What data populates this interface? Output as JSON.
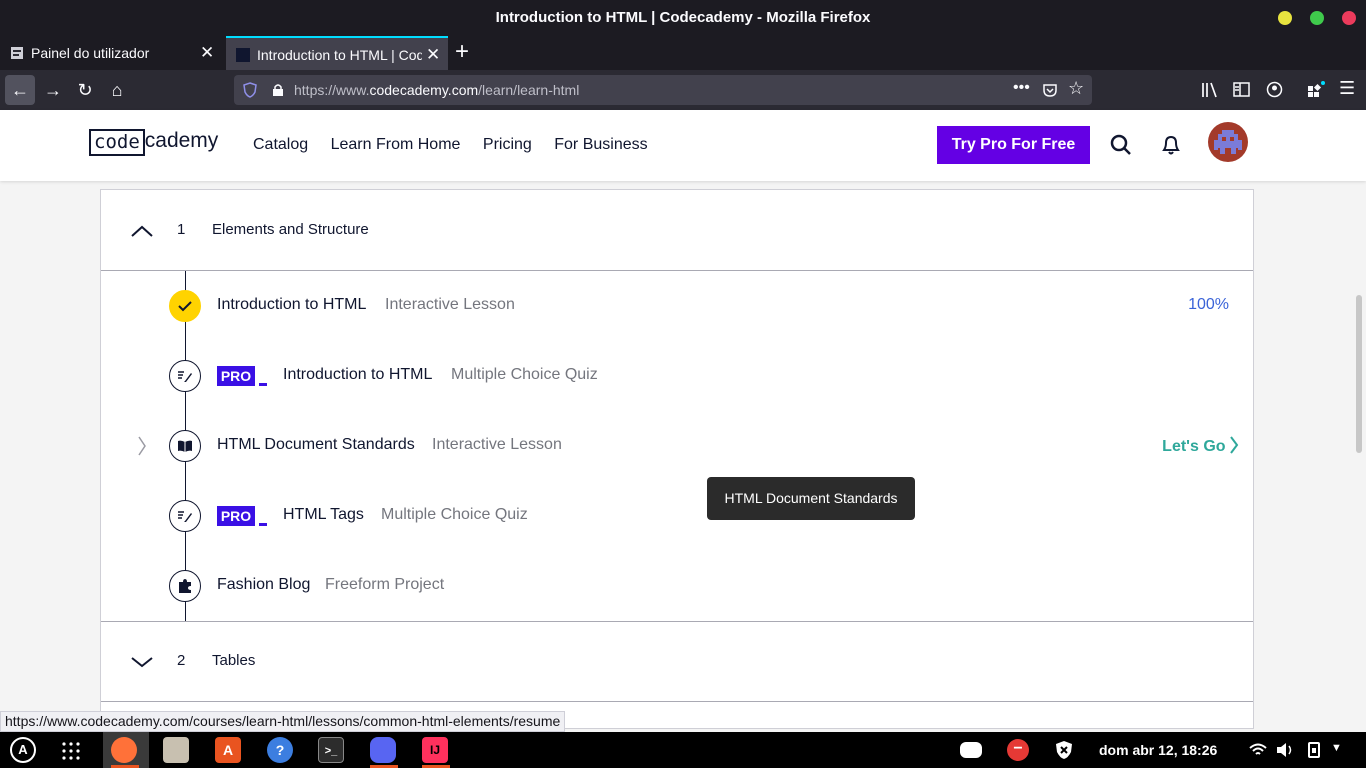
{
  "window": {
    "title": "Introduction to HTML | Codecademy - Mozilla Firefox",
    "controls": [
      "minimize-icon",
      "maximize-icon",
      "close-icon"
    ],
    "control_colors": [
      "#e7e33f",
      "#3fca4c",
      "#ec3b5c"
    ]
  },
  "tabs": [
    {
      "label": "Painel do utilizador",
      "active": false
    },
    {
      "label": "Introduction to HTML | Codecademy",
      "active": true
    }
  ],
  "navbar": {
    "url_prefix": "https://www.",
    "url_domain": "codecademy.com",
    "url_path": "/learn/learn-html"
  },
  "header": {
    "logo_left": "code",
    "logo_right": "cademy",
    "nav_items": [
      "Catalog",
      "Learn From Home",
      "Pricing",
      "For Business"
    ],
    "cta": "Try Pro For Free",
    "accent": "#6400e4"
  },
  "modules": [
    {
      "number": "1",
      "name": "Elements and Structure",
      "expanded": true
    },
    {
      "number": "2",
      "name": "Tables",
      "expanded": false
    }
  ],
  "items": [
    {
      "title": "Introduction to HTML",
      "kind": "Interactive Lesson",
      "pro": false,
      "status": "100%",
      "icon": "check-icon"
    },
    {
      "title": "Introduction to HTML",
      "kind": "Multiple Choice Quiz",
      "pro": true,
      "icon": "quiz-icon"
    },
    {
      "title": "HTML Document Standards",
      "kind": "Interactive Lesson",
      "pro": false,
      "action": "Let's Go",
      "icon": "book-icon"
    },
    {
      "title": "HTML Tags",
      "kind": "Multiple Choice Quiz",
      "pro": true,
      "icon": "quiz-icon"
    },
    {
      "title": "Fashion Blog",
      "kind": "Freeform Project",
      "pro": false,
      "icon": "puzzle-icon"
    }
  ],
  "pro_label": "PRO",
  "tooltip": "HTML Document Standards",
  "status_url": "https://www.codecademy.com/courses/learn-html/lessons/common-html-elements/resume",
  "taskbar": {
    "clock": "dom abr 12, 18:26"
  }
}
